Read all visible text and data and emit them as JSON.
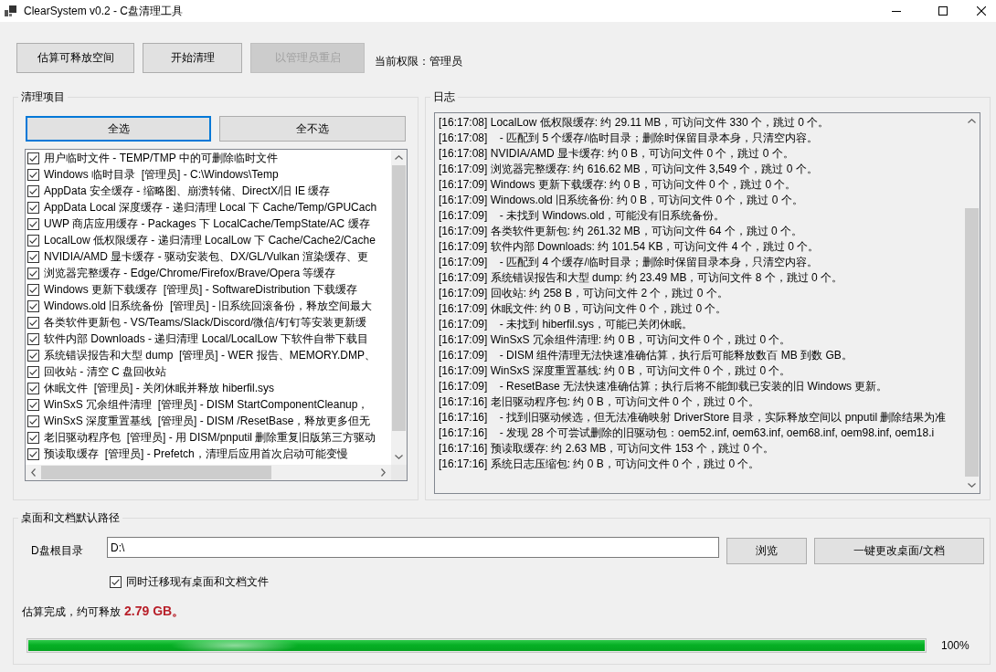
{
  "window": {
    "title": "ClearSystem v0.2 - C盘清理工具"
  },
  "toolbar": {
    "buttons": [
      {
        "label": "估算可释放空间",
        "disabled": false
      },
      {
        "label": "开始清理",
        "disabled": false
      },
      {
        "label": "以管理员重启",
        "disabled": true
      }
    ],
    "permission": "当前权限：管理员"
  },
  "cleanup_group": {
    "title": "清理项目",
    "select_buttons": [
      {
        "label": "全选",
        "focused": true
      },
      {
        "label": "全不选",
        "focused": false
      }
    ],
    "items": [
      {
        "label": "用户临时文件 - TEMP/TMP 中的可删除临时文件",
        "checked": true
      },
      {
        "label": "Windows 临时目录  [管理员] - C:\\Windows\\Temp",
        "checked": true
      },
      {
        "label": "AppData 安全缓存 - 缩略图、崩溃转储、DirectX/旧 IE 缓存",
        "checked": true
      },
      {
        "label": "AppData Local 深度缓存 - 递归清理 Local 下 Cache/Temp/GPUCach",
        "checked": true
      },
      {
        "label": "UWP 商店应用缓存 - Packages 下 LocalCache/TempState/AC 缓存",
        "checked": true
      },
      {
        "label": "LocalLow 低权限缓存 - 递归清理 LocalLow 下 Cache/Cache2/Cache",
        "checked": true
      },
      {
        "label": "NVIDIA/AMD 显卡缓存 - 驱动安装包、DX/GL/Vulkan 渲染缓存、更",
        "checked": true
      },
      {
        "label": "浏览器完整缓存 - Edge/Chrome/Firefox/Brave/Opera 等缓存",
        "checked": true
      },
      {
        "label": "Windows 更新下载缓存  [管理员] - SoftwareDistribution 下载缓存",
        "checked": true
      },
      {
        "label": "Windows.old 旧系统备份  [管理员] - 旧系统回滚备份，释放空间最大",
        "checked": true
      },
      {
        "label": "各类软件更新包 - VS/Teams/Slack/Discord/微信/钉钉等安装更新缓",
        "checked": true
      },
      {
        "label": "软件内部 Downloads - 递归清理 Local/LocalLow 下软件自带下载目",
        "checked": true
      },
      {
        "label": "系统错误报告和大型 dump  [管理员] - WER 报告、MEMORY.DMP、",
        "checked": true
      },
      {
        "label": "回收站 - 清空 C 盘回收站",
        "checked": true
      },
      {
        "label": "休眠文件  [管理员] - 关闭休眠并释放 hiberfil.sys",
        "checked": true
      },
      {
        "label": "WinSxS 冗余组件清理  [管理员] - DISM StartComponentCleanup，",
        "checked": true
      },
      {
        "label": "WinSxS 深度重置基线  [管理员] - DISM /ResetBase，释放更多但无",
        "checked": true
      },
      {
        "label": "老旧驱动程序包  [管理员] - 用 DISM/pnputil 删除重复旧版第三方驱动",
        "checked": true
      },
      {
        "label": "预读取缓存  [管理员] - Prefetch，清理后应用首次启动可能变慢",
        "checked": true
      }
    ]
  },
  "log_group": {
    "title": "日志",
    "lines": [
      "[16:17:08] LocalLow 低权限缓存: 约 29.11 MB，可访问文件 330 个，跳过 0 个。",
      "[16:17:08]    - 匹配到 5 个缓存/临时目录；删除时保留目录本身，只清空内容。",
      "[16:17:08] NVIDIA/AMD 显卡缓存: 约 0 B，可访问文件 0 个，跳过 0 个。",
      "[16:17:09] 浏览器完整缓存: 约 616.62 MB，可访问文件 3,549 个，跳过 0 个。",
      "[16:17:09] Windows 更新下载缓存: 约 0 B，可访问文件 0 个，跳过 0 个。",
      "[16:17:09] Windows.old 旧系统备份: 约 0 B，可访问文件 0 个，跳过 0 个。",
      "[16:17:09]    - 未找到 Windows.old，可能没有旧系统备份。",
      "[16:17:09] 各类软件更新包: 约 261.32 MB，可访问文件 64 个，跳过 0 个。",
      "[16:17:09] 软件内部 Downloads: 约 101.54 KB，可访问文件 4 个，跳过 0 个。",
      "[16:17:09]    - 匹配到 4 个缓存/临时目录；删除时保留目录本身，只清空内容。",
      "[16:17:09] 系统错误报告和大型 dump: 约 23.49 MB，可访问文件 8 个，跳过 0 个。",
      "[16:17:09] 回收站: 约 258 B，可访问文件 2 个，跳过 0 个。",
      "[16:17:09] 休眠文件: 约 0 B，可访问文件 0 个，跳过 0 个。",
      "[16:17:09]    - 未找到 hiberfil.sys，可能已关闭休眠。",
      "[16:17:09] WinSxS 冗余组件清理: 约 0 B，可访问文件 0 个，跳过 0 个。",
      "[16:17:09]    - DISM 组件清理无法快速准确估算，执行后可能释放数百 MB 到数 GB。",
      "[16:17:09] WinSxS 深度重置基线: 约 0 B，可访问文件 0 个，跳过 0 个。",
      "[16:17:09]    - ResetBase 无法快速准确估算；执行后将不能卸载已安装的旧 Windows 更新。",
      "[16:17:16] 老旧驱动程序包: 约 0 B，可访问文件 0 个，跳过 0 个。",
      "[16:17:16]    - 找到旧驱动候选，但无法准确映射 DriverStore 目录，实际释放空间以 pnputil 删除结果为准",
      "[16:17:16]    - 发现 28 个可尝试删除的旧驱动包：oem52.inf, oem63.inf, oem68.inf, oem98.inf, oem18.i",
      "[16:17:16] 预读取缓存: 约 2.63 MB，可访问文件 153 个，跳过 0 个。",
      "[16:17:16] 系统日志压缩包: 约 0 B，可访问文件 0 个，跳过 0 个。"
    ]
  },
  "paths_group": {
    "title": "桌面和文档默认路径",
    "field_label": "D盘根目录",
    "path_value": "D:\\",
    "browse_button": "浏览",
    "apply_button": "一键更改桌面/文档",
    "migrate": {
      "label": "同时迁移现有桌面和文档文件",
      "checked": true
    },
    "status": {
      "text": "估算完成，约可释放",
      "amount": "2.79 GB。"
    },
    "progress": {
      "level": 1,
      "reading": "100%"
    }
  }
}
